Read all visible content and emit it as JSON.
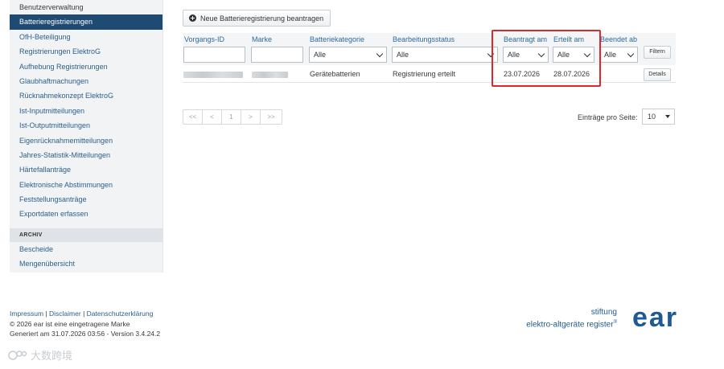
{
  "sidebar": {
    "items": [
      {
        "label": "Benutzerverwaltung"
      },
      {
        "label": "Batterieregistrierungen"
      },
      {
        "label": "OfH-Beteiligung"
      },
      {
        "label": "Registrierungen ElektroG"
      },
      {
        "label": "Aufhebung Registrierungen"
      },
      {
        "label": "Glaubhaftmachungen"
      },
      {
        "label": "Rücknahmekonzept ElektroG"
      },
      {
        "label": "Ist-Inputmitteilungen"
      },
      {
        "label": "Ist-Outputmitteilungen"
      },
      {
        "label": "Eigenrücknahmemitteilungen"
      },
      {
        "label": "Jahres-Statistik-Mitteilungen"
      },
      {
        "label": "Härtefallanträge"
      },
      {
        "label": "Elektronische Abstimmungen"
      },
      {
        "label": "Feststellungsanträge"
      },
      {
        "label": "Exportdaten erfassen"
      }
    ],
    "section_archiv": "ARCHIV",
    "archive_items": [
      {
        "label": "Bescheide"
      },
      {
        "label": "Mengenübersicht"
      }
    ]
  },
  "toolbar": {
    "new_label": "Neue Batterieregistrierung beantragen"
  },
  "table": {
    "headers": {
      "vorgangs_id": "Vorgangs-ID",
      "marke": "Marke",
      "kategorie": "Batteriekategorie",
      "status": "Bearbeitungsstatus",
      "beantragt": "Beantragt am",
      "erteilt": "Erteilt am",
      "beendet": "Beendet ab"
    },
    "filters": {
      "kategorie": "Alle",
      "status": "Alle",
      "beantragt": "Alle",
      "erteilt": "Alle",
      "beendet": "Alle"
    },
    "filter_button": "Filtern",
    "rows": [
      {
        "kategorie": "Gerätebatterien",
        "status": "Registrierung erteilt",
        "beantragt": "23.07.2026",
        "erteilt": "28.07.2026",
        "details": "Details"
      }
    ]
  },
  "pagination": {
    "first": "<<",
    "prev": "<",
    "page": "1",
    "next": ">",
    "last": ">>",
    "per_page_label": "Einträge pro Seite:",
    "per_page_value": "10"
  },
  "footer": {
    "impressum": "Impressum",
    "disclaimer": "Disclaimer",
    "datenschutz": "Datenschutzerklärung",
    "sep": "|",
    "copyright": "© 2026 ear ist eine eingetragene Marke",
    "generated": "Generiert am 31.07.2026 03:56 - Version 3.4.24.2"
  },
  "brand": {
    "line1": "stiftung",
    "line2": "elektro-altgeräte register",
    "reg": "®",
    "logo": "ear"
  },
  "watermark": {
    "text": "大数跨境"
  },
  "colors": {
    "accent": "#1f4a72",
    "highlight": "#e0262b",
    "link": "#2c6aa0"
  }
}
